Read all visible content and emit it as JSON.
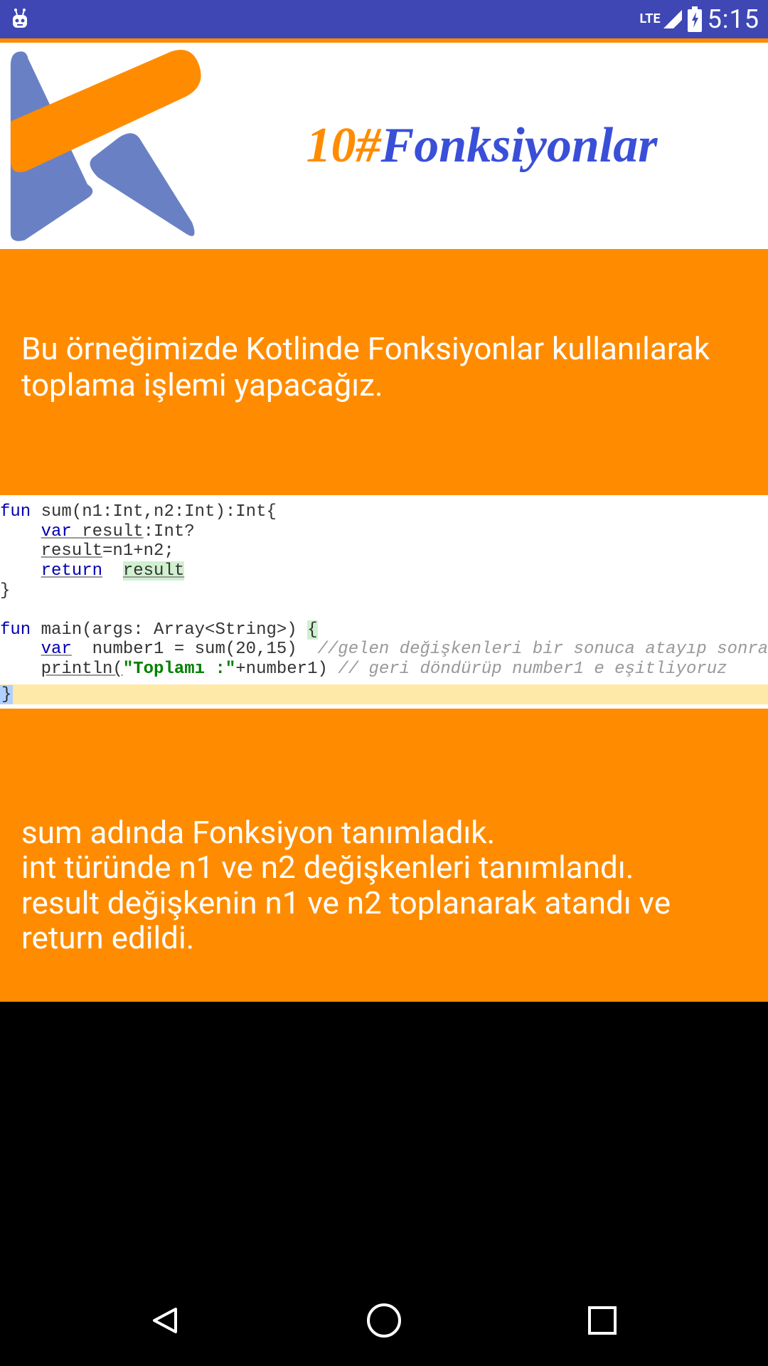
{
  "statusBar": {
    "networkLabel": "LTE",
    "time": "5:15"
  },
  "header": {
    "titleNumber": "10#",
    "titleWord": "Fonksiyonlar"
  },
  "intro": {
    "text": "Bu örneğimizde Kotlinde Fonksiyonlar kullanılarak toplama işlemi  yapacağız."
  },
  "code": {
    "line1_fun": "fun",
    "line1_rest": " sum(n1:Int,n2:Int):Int{",
    "line2_var": "var",
    "line2_result": " result",
    "line2_rest": ":Int?",
    "line3_result": "result",
    "line3_rest": "=n1+n2;",
    "line4_return": "return",
    "line4_result": "result",
    "line5": "}",
    "line7_fun": "fun",
    "line7_rest": " main(args: Array<String>) ",
    "line7_brace": "{",
    "line8_var": "var",
    "line8_mid": "  number1 = sum(20,15)  ",
    "line8_comment": "//gelen değişkenleri bir sonuca atayıp sonrasında",
    "line9_print": "println(",
    "line9_str": "\"Toplamı :\"",
    "line9_mid": "+number1) ",
    "line9_comment": "// geri döndürüp number1 e eşitliyoruz",
    "cursor": "}"
  },
  "explanation": {
    "text": "sum adında Fonksiyon tanımladık.\nint türünde n1 ve n2 değişkenleri tanımlandı.\nresult değişkenin n1 ve n2 toplanarak atandı ve return edildi."
  }
}
